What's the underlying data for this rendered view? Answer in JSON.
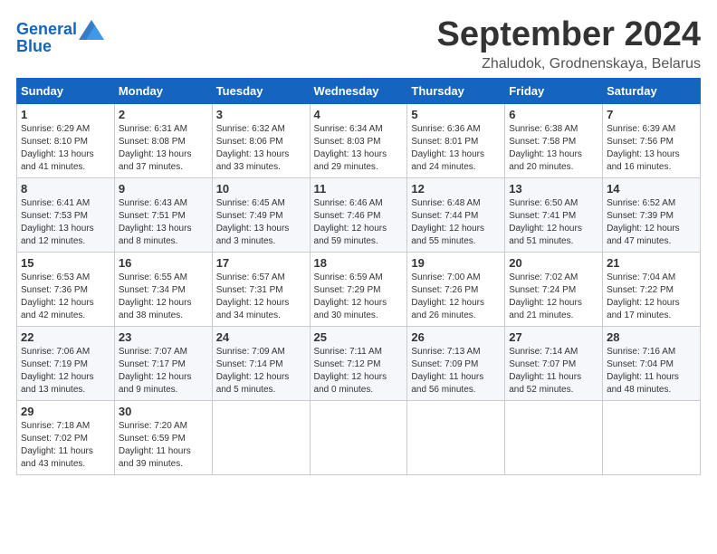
{
  "header": {
    "logo_line1": "General",
    "logo_line2": "Blue",
    "month": "September 2024",
    "location": "Zhaludok, Grodnenskaya, Belarus"
  },
  "weekdays": [
    "Sunday",
    "Monday",
    "Tuesday",
    "Wednesday",
    "Thursday",
    "Friday",
    "Saturday"
  ],
  "weeks": [
    [
      {
        "day": "1",
        "lines": [
          "Sunrise: 6:29 AM",
          "Sunset: 8:10 PM",
          "Daylight: 13 hours",
          "and 41 minutes."
        ]
      },
      {
        "day": "2",
        "lines": [
          "Sunrise: 6:31 AM",
          "Sunset: 8:08 PM",
          "Daylight: 13 hours",
          "and 37 minutes."
        ]
      },
      {
        "day": "3",
        "lines": [
          "Sunrise: 6:32 AM",
          "Sunset: 8:06 PM",
          "Daylight: 13 hours",
          "and 33 minutes."
        ]
      },
      {
        "day": "4",
        "lines": [
          "Sunrise: 6:34 AM",
          "Sunset: 8:03 PM",
          "Daylight: 13 hours",
          "and 29 minutes."
        ]
      },
      {
        "day": "5",
        "lines": [
          "Sunrise: 6:36 AM",
          "Sunset: 8:01 PM",
          "Daylight: 13 hours",
          "and 24 minutes."
        ]
      },
      {
        "day": "6",
        "lines": [
          "Sunrise: 6:38 AM",
          "Sunset: 7:58 PM",
          "Daylight: 13 hours",
          "and 20 minutes."
        ]
      },
      {
        "day": "7",
        "lines": [
          "Sunrise: 6:39 AM",
          "Sunset: 7:56 PM",
          "Daylight: 13 hours",
          "and 16 minutes."
        ]
      }
    ],
    [
      {
        "day": "8",
        "lines": [
          "Sunrise: 6:41 AM",
          "Sunset: 7:53 PM",
          "Daylight: 13 hours",
          "and 12 minutes."
        ]
      },
      {
        "day": "9",
        "lines": [
          "Sunrise: 6:43 AM",
          "Sunset: 7:51 PM",
          "Daylight: 13 hours",
          "and 8 minutes."
        ]
      },
      {
        "day": "10",
        "lines": [
          "Sunrise: 6:45 AM",
          "Sunset: 7:49 PM",
          "Daylight: 13 hours",
          "and 3 minutes."
        ]
      },
      {
        "day": "11",
        "lines": [
          "Sunrise: 6:46 AM",
          "Sunset: 7:46 PM",
          "Daylight: 12 hours",
          "and 59 minutes."
        ]
      },
      {
        "day": "12",
        "lines": [
          "Sunrise: 6:48 AM",
          "Sunset: 7:44 PM",
          "Daylight: 12 hours",
          "and 55 minutes."
        ]
      },
      {
        "day": "13",
        "lines": [
          "Sunrise: 6:50 AM",
          "Sunset: 7:41 PM",
          "Daylight: 12 hours",
          "and 51 minutes."
        ]
      },
      {
        "day": "14",
        "lines": [
          "Sunrise: 6:52 AM",
          "Sunset: 7:39 PM",
          "Daylight: 12 hours",
          "and 47 minutes."
        ]
      }
    ],
    [
      {
        "day": "15",
        "lines": [
          "Sunrise: 6:53 AM",
          "Sunset: 7:36 PM",
          "Daylight: 12 hours",
          "and 42 minutes."
        ]
      },
      {
        "day": "16",
        "lines": [
          "Sunrise: 6:55 AM",
          "Sunset: 7:34 PM",
          "Daylight: 12 hours",
          "and 38 minutes."
        ]
      },
      {
        "day": "17",
        "lines": [
          "Sunrise: 6:57 AM",
          "Sunset: 7:31 PM",
          "Daylight: 12 hours",
          "and 34 minutes."
        ]
      },
      {
        "day": "18",
        "lines": [
          "Sunrise: 6:59 AM",
          "Sunset: 7:29 PM",
          "Daylight: 12 hours",
          "and 30 minutes."
        ]
      },
      {
        "day": "19",
        "lines": [
          "Sunrise: 7:00 AM",
          "Sunset: 7:26 PM",
          "Daylight: 12 hours",
          "and 26 minutes."
        ]
      },
      {
        "day": "20",
        "lines": [
          "Sunrise: 7:02 AM",
          "Sunset: 7:24 PM",
          "Daylight: 12 hours",
          "and 21 minutes."
        ]
      },
      {
        "day": "21",
        "lines": [
          "Sunrise: 7:04 AM",
          "Sunset: 7:22 PM",
          "Daylight: 12 hours",
          "and 17 minutes."
        ]
      }
    ],
    [
      {
        "day": "22",
        "lines": [
          "Sunrise: 7:06 AM",
          "Sunset: 7:19 PM",
          "Daylight: 12 hours",
          "and 13 minutes."
        ]
      },
      {
        "day": "23",
        "lines": [
          "Sunrise: 7:07 AM",
          "Sunset: 7:17 PM",
          "Daylight: 12 hours",
          "and 9 minutes."
        ]
      },
      {
        "day": "24",
        "lines": [
          "Sunrise: 7:09 AM",
          "Sunset: 7:14 PM",
          "Daylight: 12 hours",
          "and 5 minutes."
        ]
      },
      {
        "day": "25",
        "lines": [
          "Sunrise: 7:11 AM",
          "Sunset: 7:12 PM",
          "Daylight: 12 hours",
          "and 0 minutes."
        ]
      },
      {
        "day": "26",
        "lines": [
          "Sunrise: 7:13 AM",
          "Sunset: 7:09 PM",
          "Daylight: 11 hours",
          "and 56 minutes."
        ]
      },
      {
        "day": "27",
        "lines": [
          "Sunrise: 7:14 AM",
          "Sunset: 7:07 PM",
          "Daylight: 11 hours",
          "and 52 minutes."
        ]
      },
      {
        "day": "28",
        "lines": [
          "Sunrise: 7:16 AM",
          "Sunset: 7:04 PM",
          "Daylight: 11 hours",
          "and 48 minutes."
        ]
      }
    ],
    [
      {
        "day": "29",
        "lines": [
          "Sunrise: 7:18 AM",
          "Sunset: 7:02 PM",
          "Daylight: 11 hours",
          "and 43 minutes."
        ]
      },
      {
        "day": "30",
        "lines": [
          "Sunrise: 7:20 AM",
          "Sunset: 6:59 PM",
          "Daylight: 11 hours",
          "and 39 minutes."
        ]
      },
      {
        "day": "",
        "lines": []
      },
      {
        "day": "",
        "lines": []
      },
      {
        "day": "",
        "lines": []
      },
      {
        "day": "",
        "lines": []
      },
      {
        "day": "",
        "lines": []
      }
    ]
  ]
}
